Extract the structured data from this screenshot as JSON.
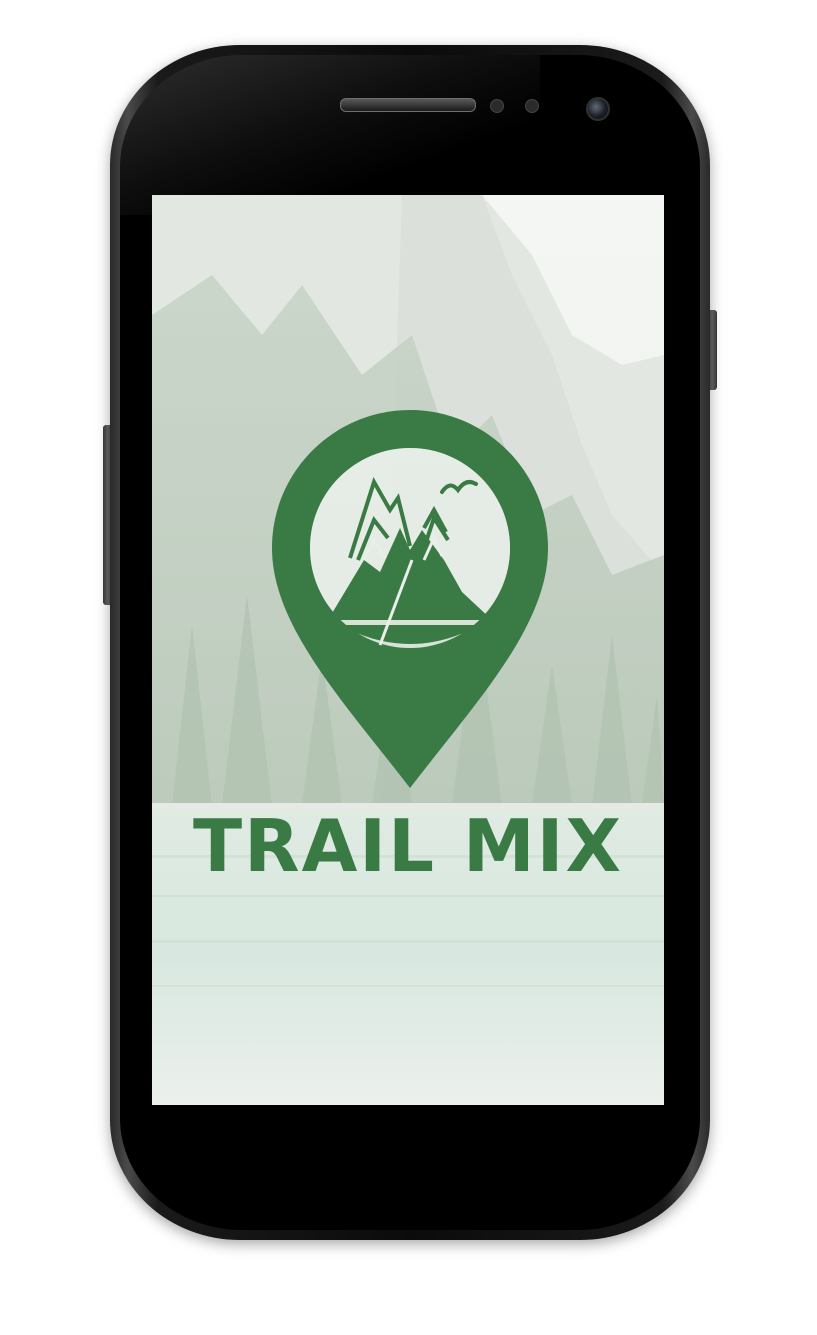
{
  "app": {
    "title": "TRAIL MIX"
  },
  "icons": {
    "logo": "map-pin-mountain-icon",
    "bird": "bird-icon"
  },
  "colors": {
    "brand_green": "#3a7a44",
    "bezel": "#0b0b0b",
    "screen_tint": "#e6ece6"
  }
}
